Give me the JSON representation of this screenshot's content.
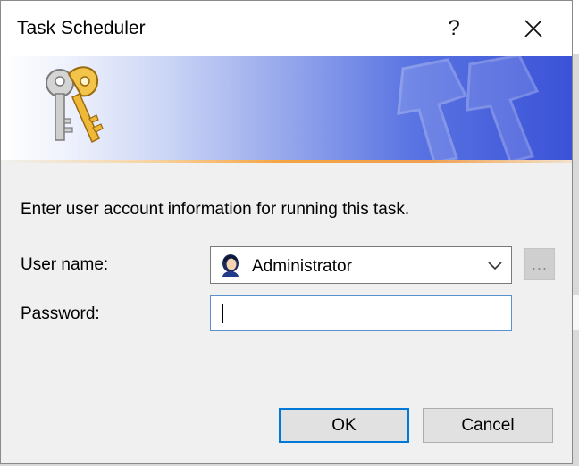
{
  "window": {
    "title": "Task Scheduler",
    "help_glyph": "?",
    "close_icon": "close-icon"
  },
  "banner": {
    "icon": "keys-icon",
    "accent_start": "#ffffff",
    "accent_end": "#3a52d7",
    "stripe_color": "#f5a340"
  },
  "form": {
    "prompt": "Enter user account information for running this task.",
    "user_label": "User name:",
    "user_value": "Administrator",
    "user_icon": "user-avatar-icon",
    "browse_label": "...",
    "password_label": "Password:",
    "password_value": ""
  },
  "buttons": {
    "ok": "OK",
    "cancel": "Cancel"
  }
}
